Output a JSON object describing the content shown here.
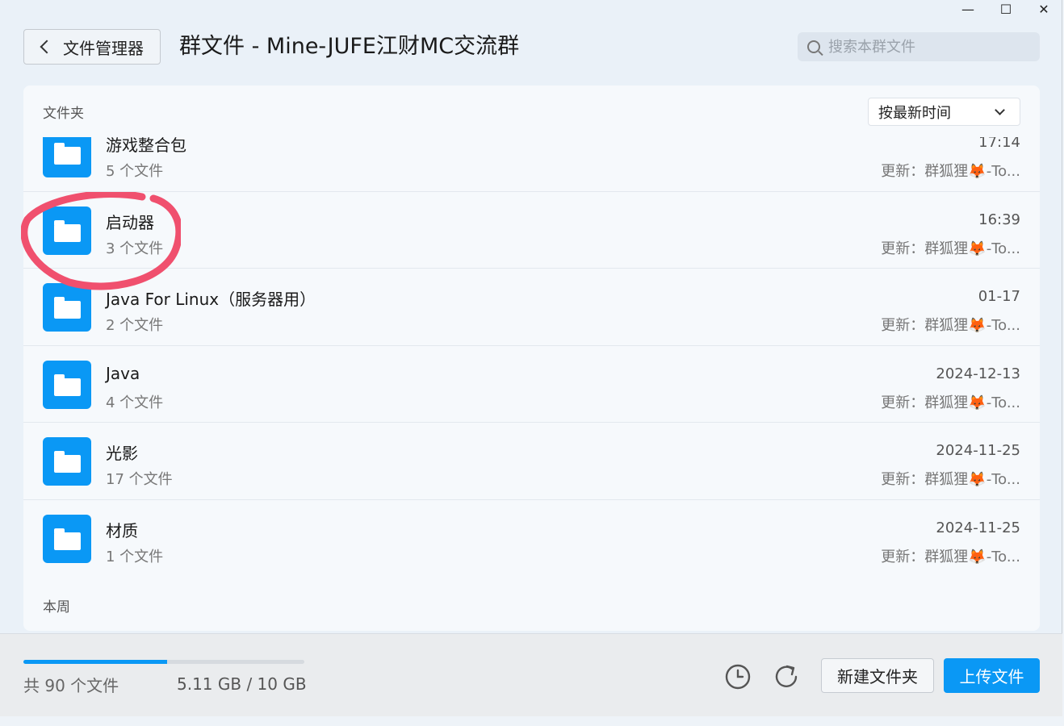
{
  "window": {
    "title": "群文件 - Mine-JUFE江财MC交流群",
    "back_label": "文件管理器",
    "controls": {
      "minimize": "—",
      "maximize": "☐",
      "close": "✕"
    }
  },
  "search": {
    "placeholder": "搜索本群文件"
  },
  "sections": {
    "folders_label": "文件夹",
    "this_week_label": "本周"
  },
  "sort": {
    "selected": "按最新时间"
  },
  "folders": [
    {
      "name": "游戏整合包",
      "count": "5 个文件",
      "date": "17:14",
      "updated": "更新：群狐狸🦊-To..."
    },
    {
      "name": "启动器",
      "count": "3 个文件",
      "date": "16:39",
      "updated": "更新：群狐狸🦊-To..."
    },
    {
      "name": "Java For Linux（服务器用）",
      "count": "2 个文件",
      "date": "01-17",
      "updated": "更新：群狐狸🦊-To..."
    },
    {
      "name": "Java",
      "count": "4 个文件",
      "date": "2024-12-13",
      "updated": "更新：群狐狸🦊-To..."
    },
    {
      "name": "光影",
      "count": "17 个文件",
      "date": "2024-11-25",
      "updated": "更新：群狐狸🦊-To..."
    },
    {
      "name": "材质",
      "count": "1 个文件",
      "date": "2024-11-25",
      "updated": "更新：群狐狸🦊-To..."
    }
  ],
  "footer": {
    "file_count": "共 90 个文件",
    "storage": "5.11 GB / 10 GB",
    "storage_used_fraction": 0.511,
    "new_folder_label": "新建文件夹",
    "upload_label": "上传文件"
  },
  "colors": {
    "accent": "#0a98f5",
    "annotation": "#f0506e"
  }
}
